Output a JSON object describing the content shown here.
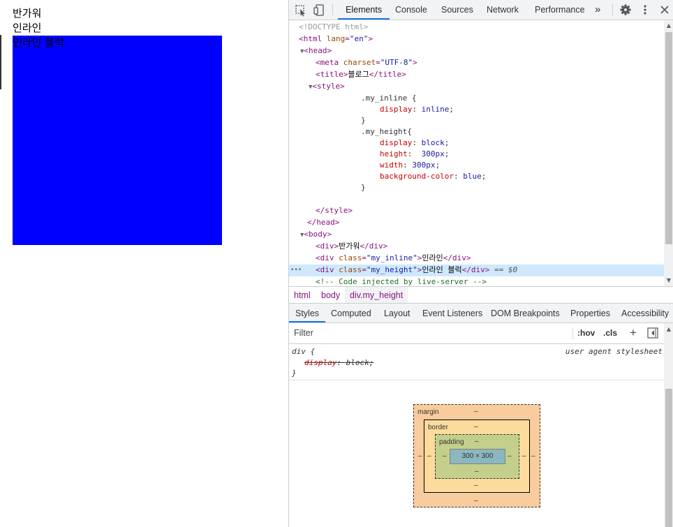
{
  "page": {
    "lines": [
      "반가워",
      "인라인",
      "인라인 블럭"
    ],
    "box_color": "#0000ff"
  },
  "devtools": {
    "toolbar": {
      "tabs": [
        "Elements",
        "Console",
        "Sources",
        "Network",
        "Performance"
      ],
      "active_tab": "Elements",
      "more_glyph": "»"
    },
    "tree": {
      "doctype": "<!DOCTYPE html>",
      "html_open": "html",
      "html_attr_name": "lang",
      "html_attr_value": "\"en\"",
      "head": "head",
      "meta": "meta",
      "meta_attr_name": "charset",
      "meta_attr_value": "\"UTF-8\"",
      "title_tag": "title",
      "title_text": "블로그",
      "style_tag": "style",
      "css": {
        "sel1": ".my_inline {",
        "p1": "display",
        "v1": "inline",
        "close1": "}",
        "sel2": ".my_height{",
        "p2": "display",
        "v2": "block",
        "p3": "height",
        "v3": "300px",
        "p4": "width",
        "v4": "300px",
        "p5": "background-color",
        "v5": "blue",
        "close2": "}"
      },
      "style_close": "style",
      "head_close": "head",
      "body": "body",
      "div_tag": "div",
      "div1_text": "반가워",
      "class_attr": "class",
      "div2_class": "\"my_inline\"",
      "div2_text": "인라인",
      "div3_class": "\"my_height\"",
      "div3_text": "인라인 블럭",
      "selected_marker": "== $0",
      "comment": "<!-- Code injected by live-server -->",
      "dots": "•••"
    },
    "breadcrumbs": [
      "html",
      "body",
      "div.my_height"
    ],
    "subtabs": [
      "Styles",
      "Computed",
      "Layout",
      "Event Listeners",
      "DOM Breakpoints",
      "Properties",
      "Accessibility"
    ],
    "active_subtab": "Styles",
    "filter": {
      "placeholder": "Filter",
      "hov": ":hov",
      "cls": ".cls",
      "plus": "+"
    },
    "rule": {
      "selector": "div {",
      "source": "user agent stylesheet",
      "prop": "display",
      "value": "block;",
      "close": "}"
    },
    "box_model": {
      "margin_label": "margin",
      "border_label": "border",
      "padding_label": "padding",
      "content_size": "300 × 300",
      "dash": "–",
      "colors": {
        "margin": "#f9cc9d",
        "border": "#fcdb9c",
        "padding": "#c3d08b",
        "content": "#8cb6c0"
      }
    }
  }
}
